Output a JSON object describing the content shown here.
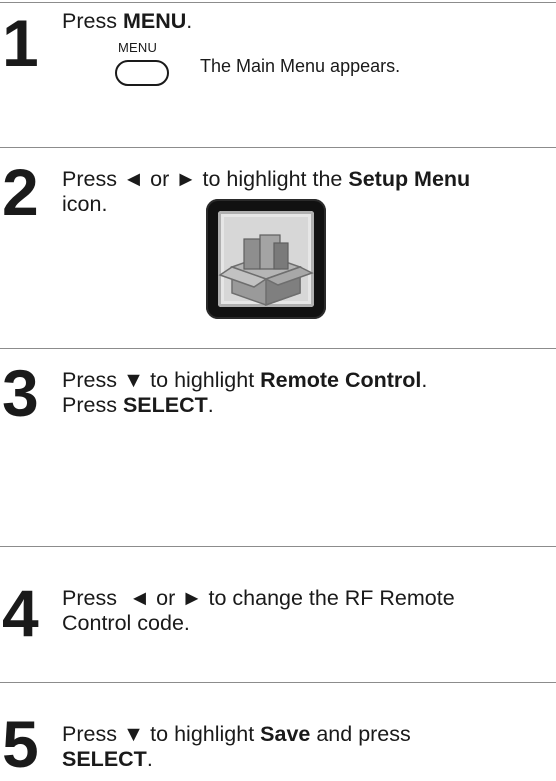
{
  "steps": [
    {
      "number": "1",
      "line1": {
        "pre": "Press ",
        "bold": "MENU",
        "post": "."
      },
      "button_label": "MENU",
      "note": "The Main Menu appears."
    },
    {
      "number": "2",
      "line1": {
        "pre": "Press ◄ or ► to highlight the ",
        "bold": "Setup Menu",
        "post": ""
      },
      "line2": "icon.",
      "icon": "setup-menu-box-icon"
    },
    {
      "number": "3",
      "line1": {
        "pre": "Press ▼ to highlight ",
        "bold": "Remote Control",
        "post": "."
      },
      "line2": {
        "pre": "Press ",
        "bold": "SELECT",
        "post": "."
      }
    },
    {
      "number": "4",
      "line1": "Press  ◄ or ► to change the RF Remote",
      "line2": "Control code."
    },
    {
      "number": "5",
      "line1": {
        "pre": "Press ▼ to highlight ",
        "bold": "Save",
        "post": " and press"
      },
      "line2": {
        "pre": "",
        "bold": "SELECT",
        "post": "."
      }
    }
  ],
  "colors": {
    "text": "#1a1a1a",
    "rule": "#8c8c8c",
    "icon_frame": "#111111"
  }
}
